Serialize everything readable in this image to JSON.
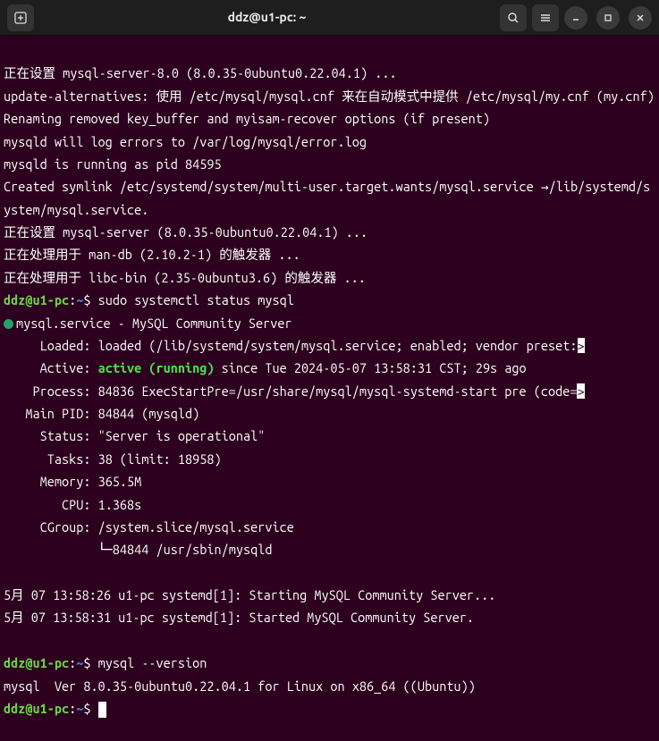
{
  "titlebar": {
    "title": "ddz@u1-pc: ~"
  },
  "prompt": {
    "user_host": "ddz@u1-pc",
    "sep": ":",
    "path": "~",
    "sym": "$"
  },
  "cmd": {
    "status": "sudo systemctl status mysql",
    "version": "mysql --version"
  },
  "out": {
    "l1": "正在设置 mysql-server-8.0 (8.0.35-0ubuntu0.22.04.1) ...",
    "l2": "update-alternatives: 使用 /etc/mysql/mysql.cnf 来在自动模式中提供 /etc/mysql/my.cnf (my.cnf)",
    "l3": "Renaming removed key_buffer and myisam-recover options (if present)",
    "l4": "mysqld will log errors to /var/log/mysql/error.log",
    "l5": "mysqld is running as pid 84595",
    "l6": "Created symlink /etc/systemd/system/multi-user.target.wants/mysql.service →/lib/systemd/system/mysql.service.",
    "l7": "正在设置 mysql-server (8.0.35-0ubuntu0.22.04.1) ...",
    "l8": "正在处理用于 man-db (2.10.2-1) 的触发器 ...",
    "l9": "正在处理用于 libc-bin (2.35-0ubuntu3.6) 的触发器 ..."
  },
  "status": {
    "header": "mysql.service - MySQL Community Server",
    "loaded_pre": "     Loaded: loaded (/lib/systemd/system/mysql.service; enabled; vendor preset:",
    "loaded_tail": ">",
    "active_pre": "     Active: ",
    "active_state": "active (running)",
    "active_post": " since Tue 2024-05-07 13:58:31 CST; 29s ago",
    "process_pre": "    Process: 84836 ExecStartPre=/usr/share/mysql/mysql-systemd-start pre (code=",
    "process_tail": ">",
    "mainpid": "   Main PID: 84844 (mysqld)",
    "status_line": "     Status: \"Server is operational\"",
    "tasks": "      Tasks: 38 (limit: 18958)",
    "memory": "     Memory: 365.5M",
    "cpu": "        CPU: 1.368s",
    "cgroup": "     CGroup: /system.slice/mysql.service",
    "cgroup_child": "             └─84844 /usr/sbin/mysqld",
    "log1": "5月 07 13:58:26 u1-pc systemd[1]: Starting MySQL Community Server...",
    "log2": "5月 07 13:58:31 u1-pc systemd[1]: Started MySQL Community Server."
  },
  "version_out": "mysql  Ver 8.0.35-0ubuntu0.22.04.1 for Linux on x86_64 ((Ubuntu))"
}
